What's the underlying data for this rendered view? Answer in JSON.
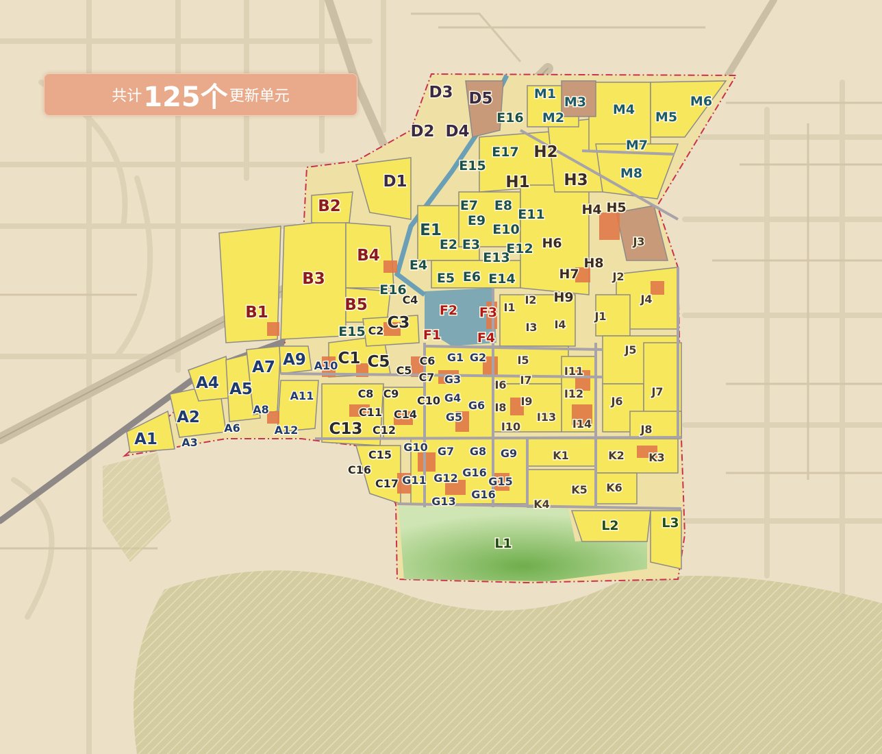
{
  "banner": {
    "prefix": "共计",
    "count": "125个",
    "suffix": "更新单元"
  },
  "colors": {
    "background": "#ece0c6",
    "parcel": "#f7e75c",
    "building": "#e0794a",
    "boundary": "#c8324f",
    "road": "#a7a3a8",
    "rail": "#7a7478",
    "water": "#6a9fb6",
    "park": "#8cc26a",
    "mountain": "#c9c193",
    "banner": "#e8aa8a"
  },
  "units": [
    {
      "id": "A1",
      "color": "#1f3a6e"
    },
    {
      "id": "A2",
      "color": "#1f3a6e"
    },
    {
      "id": "A3",
      "color": "#1f3a6e"
    },
    {
      "id": "A4",
      "color": "#1f3a6e"
    },
    {
      "id": "A5",
      "color": "#1f3a6e"
    },
    {
      "id": "A6",
      "color": "#1f3a6e"
    },
    {
      "id": "A7",
      "color": "#1f3a6e"
    },
    {
      "id": "A8",
      "color": "#1f3a6e"
    },
    {
      "id": "A9",
      "color": "#1f3a6e"
    },
    {
      "id": "A10",
      "color": "#1f3a6e"
    },
    {
      "id": "A11",
      "color": "#1f3a6e"
    },
    {
      "id": "A12",
      "color": "#1f3a6e"
    },
    {
      "id": "B1",
      "color": "#8c1c1c"
    },
    {
      "id": "B2",
      "color": "#8c1c1c"
    },
    {
      "id": "B3",
      "color": "#8c1c1c"
    },
    {
      "id": "B4",
      "color": "#8c1c1c"
    },
    {
      "id": "B5",
      "color": "#8c1c1c"
    },
    {
      "id": "C1",
      "color": "#2a2a2a"
    },
    {
      "id": "C2",
      "color": "#2a2a2a"
    },
    {
      "id": "C3",
      "color": "#2a2a2a"
    },
    {
      "id": "C4",
      "color": "#2a2a2a"
    },
    {
      "id": "C5",
      "color": "#2a2a2a"
    },
    {
      "id": "C5",
      "color": "#2a2a2a"
    },
    {
      "id": "C6",
      "color": "#2a2a2a"
    },
    {
      "id": "C7",
      "color": "#2a2a2a"
    },
    {
      "id": "C8",
      "color": "#2a2a2a"
    },
    {
      "id": "C9",
      "color": "#2a2a2a"
    },
    {
      "id": "C10",
      "color": "#2a2a2a"
    },
    {
      "id": "C11",
      "color": "#2a2a2a"
    },
    {
      "id": "C12",
      "color": "#2a2a2a"
    },
    {
      "id": "C13",
      "color": "#2a2a2a"
    },
    {
      "id": "C14",
      "color": "#2a2a2a"
    },
    {
      "id": "C15",
      "color": "#2a2a2a"
    },
    {
      "id": "C16",
      "color": "#2a2a2a"
    },
    {
      "id": "C17",
      "color": "#2a2a2a"
    },
    {
      "id": "D1",
      "color": "#3a2a44"
    },
    {
      "id": "D2",
      "color": "#3a2a44"
    },
    {
      "id": "D3",
      "color": "#3a2a44"
    },
    {
      "id": "D4",
      "color": "#3a2a44"
    },
    {
      "id": "D5",
      "color": "#3a2a44"
    },
    {
      "id": "E1",
      "color": "#1b4f4a"
    },
    {
      "id": "E2",
      "color": "#1b4f4a"
    },
    {
      "id": "E3",
      "color": "#1b4f4a"
    },
    {
      "id": "E4",
      "color": "#1b4f4a"
    },
    {
      "id": "E5",
      "color": "#1b4f4a"
    },
    {
      "id": "E6",
      "color": "#1b4f4a"
    },
    {
      "id": "E7",
      "color": "#1b4f4a"
    },
    {
      "id": "E8",
      "color": "#1b4f4a"
    },
    {
      "id": "E9",
      "color": "#1b4f4a"
    },
    {
      "id": "E10",
      "color": "#1b4f4a"
    },
    {
      "id": "E11",
      "color": "#1b4f4a"
    },
    {
      "id": "E12",
      "color": "#1b4f4a"
    },
    {
      "id": "E13",
      "color": "#1b4f4a"
    },
    {
      "id": "E14",
      "color": "#1b4f4a"
    },
    {
      "id": "E15",
      "color": "#1b4f4a"
    },
    {
      "id": "E15",
      "color": "#1b4f4a"
    },
    {
      "id": "E16",
      "color": "#1b4f4a"
    },
    {
      "id": "E16",
      "color": "#1b4f4a"
    },
    {
      "id": "E17",
      "color": "#1b4f4a"
    },
    {
      "id": "F1",
      "color": "#b01818"
    },
    {
      "id": "F2",
      "color": "#b01818"
    },
    {
      "id": "F3",
      "color": "#b01818"
    },
    {
      "id": "F4",
      "color": "#b01818"
    },
    {
      "id": "G1",
      "color": "#2b3b5a"
    },
    {
      "id": "G2",
      "color": "#2b3b5a"
    },
    {
      "id": "G3",
      "color": "#2b3b5a"
    },
    {
      "id": "G4",
      "color": "#2b3b5a"
    },
    {
      "id": "G5",
      "color": "#2b3b5a"
    },
    {
      "id": "G6",
      "color": "#2b3b5a"
    },
    {
      "id": "G7",
      "color": "#2b3b5a"
    },
    {
      "id": "G8",
      "color": "#2b3b5a"
    },
    {
      "id": "G9",
      "color": "#2b3b5a"
    },
    {
      "id": "G10",
      "color": "#2b3b5a"
    },
    {
      "id": "G11",
      "color": "#2b3b5a"
    },
    {
      "id": "G12",
      "color": "#2b3b5a"
    },
    {
      "id": "G13",
      "color": "#2b3b5a"
    },
    {
      "id": "G15",
      "color": "#2b3b5a"
    },
    {
      "id": "G16",
      "color": "#2b3b5a"
    },
    {
      "id": "G16",
      "color": "#2b3b5a"
    },
    {
      "id": "H1",
      "color": "#3b2a20"
    },
    {
      "id": "H2",
      "color": "#3b2a20"
    },
    {
      "id": "H3",
      "color": "#3b2a20"
    },
    {
      "id": "H4",
      "color": "#3b2a20"
    },
    {
      "id": "H5",
      "color": "#3b2a20"
    },
    {
      "id": "H6",
      "color": "#3b2a20"
    },
    {
      "id": "H7",
      "color": "#3b2a20"
    },
    {
      "id": "H8",
      "color": "#3b2a20"
    },
    {
      "id": "H9",
      "color": "#3b2a20"
    },
    {
      "id": "I1",
      "color": "#4a3a2a"
    },
    {
      "id": "I2",
      "color": "#4a3a2a"
    },
    {
      "id": "I3",
      "color": "#4a3a2a"
    },
    {
      "id": "I4",
      "color": "#4a3a2a"
    },
    {
      "id": "I5",
      "color": "#4a3a2a"
    },
    {
      "id": "I6",
      "color": "#4a3a2a"
    },
    {
      "id": "I7",
      "color": "#4a3a2a"
    },
    {
      "id": "I8",
      "color": "#4a3a2a"
    },
    {
      "id": "I9",
      "color": "#4a3a2a"
    },
    {
      "id": "I10",
      "color": "#4a3a2a"
    },
    {
      "id": "I11",
      "color": "#4a3a2a"
    },
    {
      "id": "I12",
      "color": "#4a3a2a"
    },
    {
      "id": "I13",
      "color": "#4a3a2a"
    },
    {
      "id": "I14",
      "color": "#4a3a2a"
    },
    {
      "id": "J1",
      "color": "#4a3a2a"
    },
    {
      "id": "J2",
      "color": "#4a3a2a"
    },
    {
      "id": "J3",
      "color": "#4a3a2a"
    },
    {
      "id": "J4",
      "color": "#4a3a2a"
    },
    {
      "id": "J5",
      "color": "#4a3a2a"
    },
    {
      "id": "J6",
      "color": "#4a3a2a"
    },
    {
      "id": "J7",
      "color": "#4a3a2a"
    },
    {
      "id": "J8",
      "color": "#4a3a2a"
    },
    {
      "id": "K1",
      "color": "#4a3a2a"
    },
    {
      "id": "K2",
      "color": "#4a3a2a"
    },
    {
      "id": "K3",
      "color": "#4a3a2a"
    },
    {
      "id": "K4",
      "color": "#4a3a2a"
    },
    {
      "id": "K5",
      "color": "#4a3a2a"
    },
    {
      "id": "K6",
      "color": "#4a3a2a"
    },
    {
      "id": "L1",
      "color": "#1e4a14"
    },
    {
      "id": "L2",
      "color": "#1e4a14"
    },
    {
      "id": "L3",
      "color": "#1e4a14"
    },
    {
      "id": "M1",
      "color": "#1c5a6a"
    },
    {
      "id": "M2",
      "color": "#1c5a6a"
    },
    {
      "id": "M3",
      "color": "#1c5a6a"
    },
    {
      "id": "M4",
      "color": "#1c5a6a"
    },
    {
      "id": "M5",
      "color": "#1c5a6a"
    },
    {
      "id": "M6",
      "color": "#1c5a6a"
    },
    {
      "id": "M7",
      "color": "#1c5a6a"
    },
    {
      "id": "M8",
      "color": "#1c5a6a"
    }
  ]
}
